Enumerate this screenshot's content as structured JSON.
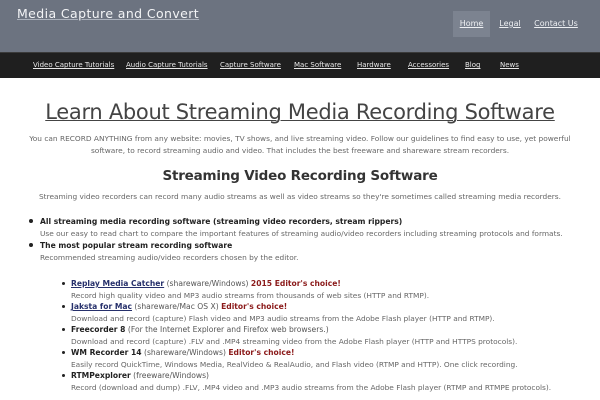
{
  "header": {
    "site_title": "Media Capture and Convert",
    "top_nav": [
      {
        "label": "Home",
        "active": true
      },
      {
        "label": "Legal",
        "active": false
      },
      {
        "label": "Contact Us",
        "active": false
      }
    ]
  },
  "nav": [
    "Video Capture Tutorials",
    "Audio Capture Tutorials",
    "Capture Software",
    "Mac Software",
    "Hardware",
    "Accessories",
    "Blog",
    "News"
  ],
  "page": {
    "title": "Learn About Streaming Media Recording Software",
    "intro": "You can RECORD ANYTHING from any website: movies, TV shows, and live streaming video. Follow our guidelines to find easy to use, yet powerful software, to record streaming audio and video. That includes the best freeware and shareware stream recorders.",
    "section_title": "Streaming Video Recording Software",
    "section_desc": "Streaming video recorders can record many audio streams as well as video streams so they're sometimes called streaming media recorders."
  },
  "bullets": [
    {
      "head": "All streaming media recording software (streaming video recorders, stream rippers)",
      "sub": "Use our easy to read chart to compare the important features of streaming audio/video recorders including streaming protocols and formats."
    },
    {
      "head": "The most popular stream recording software",
      "sub": "Recommended streaming audio/video recorders chosen by the editor."
    }
  ],
  "products": [
    {
      "name": "Replay Media Catcher",
      "type": " (shareware/Windows) ",
      "badge": "2015 Editor's choice!",
      "desc": "Record high quality video and MP3 audio streams from thousands of web sites (HTTP and RTMP).",
      "linked": true
    },
    {
      "name": "Jaksta for Mac",
      "type": " (shareware/Mac OS X) ",
      "badge": "Editor's choice!",
      "desc": "Download and record (capture) Flash video and MP3 audio streams from the Adobe Flash player (HTTP and RTMP).",
      "linked": true
    },
    {
      "name": "Freecorder 8",
      "type": " (For the Internet Explorer and Firefox web browsers.)",
      "badge": "",
      "desc": "Download and record (capture) .FLV and .MP4 streaming video from the Adobe Flash player (HTTP and HTTPS protocols).",
      "linked": false
    },
    {
      "name": "WM Recorder 14",
      "type": " (shareware/Windows) ",
      "badge": "Editor's choice!",
      "desc": "Easily record QuickTime, Windows Media, RealVideo & RealAudio, and Flash video (RTMP and HTTP). One click recording.",
      "linked": false
    },
    {
      "name": "RTMPexplorer",
      "type": " (freeware/Windows)",
      "badge": "",
      "desc": "Record (download and dump) .FLV, .MP4 video and .MP3 audio streams from the Adobe Flash player (RTMP and RTMPE protocols).",
      "linked": false
    }
  ]
}
